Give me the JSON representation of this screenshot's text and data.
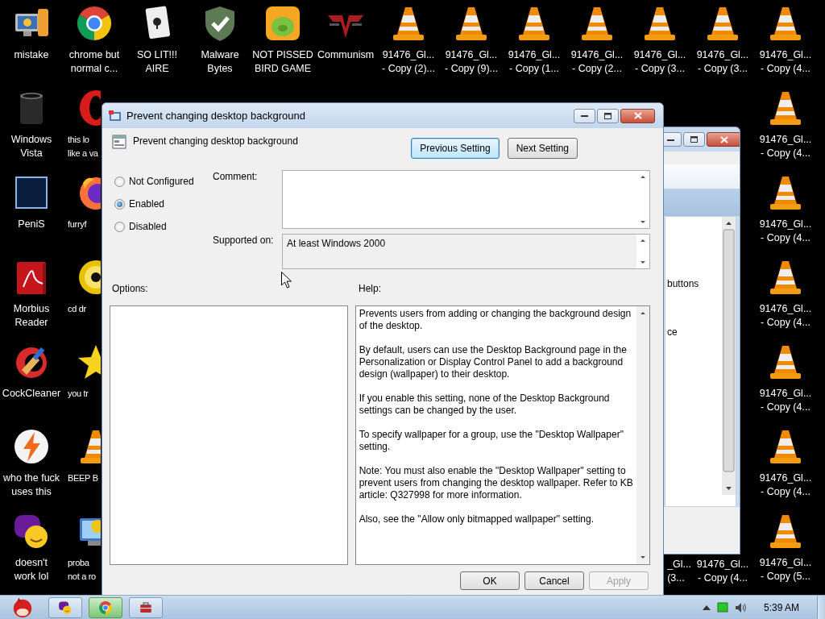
{
  "desktop": {
    "columns": [
      {
        "icons": [
          {
            "kind": "computer",
            "label": "mistake"
          },
          {
            "kind": "bin",
            "label": "Windows\nVista"
          },
          {
            "kind": "photo",
            "label": "PeniS"
          },
          {
            "kind": "pdf",
            "label": "Morbius\nReader"
          },
          {
            "kind": "cleaner",
            "label": "CockCleaner"
          },
          {
            "kind": "bolt",
            "label": "who the fuck\nuses this"
          },
          {
            "kind": "messenger",
            "label": "doesn't\nwork lol"
          }
        ]
      },
      {
        "icons": [
          {
            "kind": "chrome",
            "label": "chrome but\nnormal c..."
          },
          {
            "kind": "opera",
            "label": "this lo\nlike a va"
          },
          {
            "kind": "firefox",
            "label": "furryf"
          },
          {
            "kind": "disc",
            "label": "cd dr"
          },
          {
            "kind": "star",
            "label": "you tr"
          },
          {
            "kind": "cone",
            "label": "BEEP B"
          },
          {
            "kind": "monitor",
            "label": "proba\nnot a ro"
          }
        ]
      },
      {
        "icons": [
          {
            "kind": "cards",
            "label": "SO LIT!!!\nAIRE"
          }
        ]
      },
      {
        "icons": [
          {
            "kind": "shield",
            "label": "Malware\nBytes"
          }
        ]
      },
      {
        "icons": [
          {
            "kind": "game",
            "label": "NOT PISSED\nBIRD GAME"
          }
        ]
      },
      {
        "icons": [
          {
            "kind": "emblem",
            "label": "Communism"
          }
        ]
      },
      {
        "icons": [
          {
            "kind": "cone",
            "label": "91476_Gl...\n- Copy (2)..."
          }
        ]
      },
      {
        "icons": [
          {
            "kind": "cone",
            "label": "91476_Gl...\n- Copy (9)..."
          }
        ]
      },
      {
        "icons": [
          {
            "kind": "cone",
            "label": "91476_Gl...\n- Copy (1..."
          }
        ]
      },
      {
        "icons": [
          {
            "kind": "cone",
            "label": "91476_Gl...\n- Copy (2..."
          }
        ]
      },
      {
        "icons": [
          {
            "kind": "cone",
            "label": "91476_Gl...\n- Copy (3..."
          }
        ]
      },
      {
        "icons": [
          {
            "kind": "cone",
            "label": "91476_Gl...\n- Copy (3..."
          }
        ]
      },
      {
        "icons": [
          {
            "kind": "cone",
            "label": "91476_Gl...\n- Copy (4..."
          },
          {
            "kind": "cone",
            "label": "91476_Gl...\n- Copy (4..."
          },
          {
            "kind": "cone",
            "label": "91476_Gl...\n- Copy (4..."
          },
          {
            "kind": "cone",
            "label": "91476_Gl...\n- Copy (4..."
          },
          {
            "kind": "cone",
            "label": "91476_Gl...\n- Copy (4..."
          },
          {
            "kind": "cone",
            "label": "91476_Gl...\n- Copy (4..."
          },
          {
            "kind": "cone",
            "label": "91476_Gl...\n- Copy (5..."
          }
        ]
      }
    ],
    "bottom_labels": [
      "_Gl...\n(3...",
      "91476_Gl...\n- Copy (4..."
    ]
  },
  "background_window": {
    "list_items": [
      "buttons",
      "ce"
    ]
  },
  "dialog": {
    "title": "Prevent changing desktop background",
    "setting_name": "Prevent changing desktop background",
    "nav_buttons": [
      {
        "label": "Previous Setting",
        "focused": true
      },
      {
        "label": "Next Setting",
        "focused": false
      }
    ],
    "states": [
      {
        "label": "Not Configured",
        "selected": false
      },
      {
        "label": "Enabled",
        "selected": true
      },
      {
        "label": "Disabled",
        "selected": false
      }
    ],
    "comment_label": "Comment:",
    "supported_label": "Supported on:",
    "supported_value": "At least Windows 2000",
    "options_label": "Options:",
    "help_label": "Help:",
    "help_paragraphs": [
      "Prevents users from adding or changing the background design of the desktop.",
      "By default, users can use the Desktop Background page in the Personalization or Display Control Panel to add a background design (wallpaper) to their desktop.",
      "If you enable this setting, none of the Desktop Background settings can be changed by the user.",
      "To specify wallpaper for a group, use the \"Desktop Wallpaper\" setting.",
      "Note: You must also enable the \"Desktop Wallpaper\" setting to prevent users from changing the desktop wallpaper. Refer to KB article: Q327998 for more information.",
      "Also, see the \"Allow only bitmapped wallpaper\" setting."
    ],
    "buttons": [
      {
        "label": "OK",
        "disabled": false
      },
      {
        "label": "Cancel",
        "disabled": false
      },
      {
        "label": "Apply",
        "disabled": true
      }
    ]
  },
  "taskbar": {
    "tasks": [
      {
        "kind": "messenger",
        "active": false
      },
      {
        "kind": "chrome",
        "active": true
      },
      {
        "kind": "toolbox",
        "active": false
      }
    ],
    "clock": "5:39 AM"
  }
}
